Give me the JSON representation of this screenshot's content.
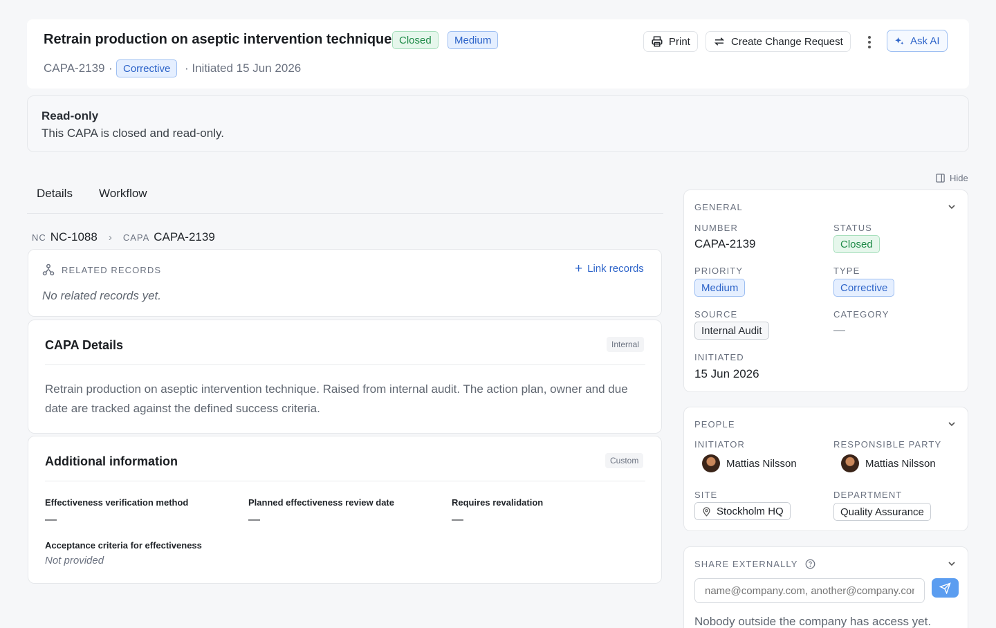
{
  "header": {
    "title": "Retrain production on aseptic intervention technique",
    "status_badge": "Closed",
    "priority_badge": "Medium",
    "id": "CAPA-2139",
    "sep1": "·",
    "type_badge": "Corrective",
    "initiated": "· Initiated 15 Jun 2026",
    "print_label": "Print",
    "change_request_label": "Create Change Request",
    "ask_ai_label": "Ask AI"
  },
  "banner": {
    "title": "Read-only",
    "text": "This CAPA is closed and read-only."
  },
  "tabs": [
    {
      "label": "Details"
    },
    {
      "label": "Workflow"
    }
  ],
  "hide_label": "Hide",
  "breadcrumb": {
    "nc_prefix": "NC",
    "nc_id": "NC-1088",
    "capa_prefix": "CAPA",
    "capa_id": "CAPA-2139"
  },
  "related": {
    "heading": "RELATED RECORDS",
    "link_label": "Link records",
    "empty": "No related records yet."
  },
  "capa_details": {
    "title": "CAPA Details",
    "tag": "Internal",
    "description": "Retrain production on aseptic intervention technique. Raised from internal audit. The action plan, owner and due date are tracked against the defined success criteria."
  },
  "additional": {
    "title": "Additional information",
    "tag": "Custom",
    "fields": [
      {
        "label": "Effectiveness verification method",
        "value": "—"
      },
      {
        "label": "Planned effectiveness review date",
        "value": "—"
      },
      {
        "label": "Requires revalidation",
        "value": "—"
      },
      {
        "label": "Acceptance criteria for effectiveness",
        "value": "Not provided"
      }
    ]
  },
  "general": {
    "heading": "GENERAL",
    "number_label": "NUMBER",
    "number": "CAPA-2139",
    "status_label": "STATUS",
    "status": "Closed",
    "priority_label": "PRIORITY",
    "priority": "Medium",
    "type_label": "TYPE",
    "type": "Corrective",
    "source_label": "SOURCE",
    "source": "Internal Audit",
    "category_label": "CATEGORY",
    "category": "—",
    "initiated_label": "INITIATED",
    "initiated": "15 Jun 2026"
  },
  "people": {
    "heading": "PEOPLE",
    "initiator_label": "INITIATOR",
    "initiator": "Mattias Nilsson",
    "responsible_label": "RESPONSIBLE PARTY",
    "responsible": "Mattias Nilsson",
    "site_label": "SITE",
    "site": "Stockholm HQ",
    "department_label": "DEPARTMENT",
    "department": "Quality Assurance"
  },
  "share": {
    "heading": "SHARE EXTERNALLY",
    "placeholder": "name@company.com, another@company.com",
    "note": "Nobody outside the company has access yet."
  },
  "colors": {
    "accent": "#2c63c9",
    "closed_green": "#1e8a47",
    "send_button": "#5b9df0"
  }
}
